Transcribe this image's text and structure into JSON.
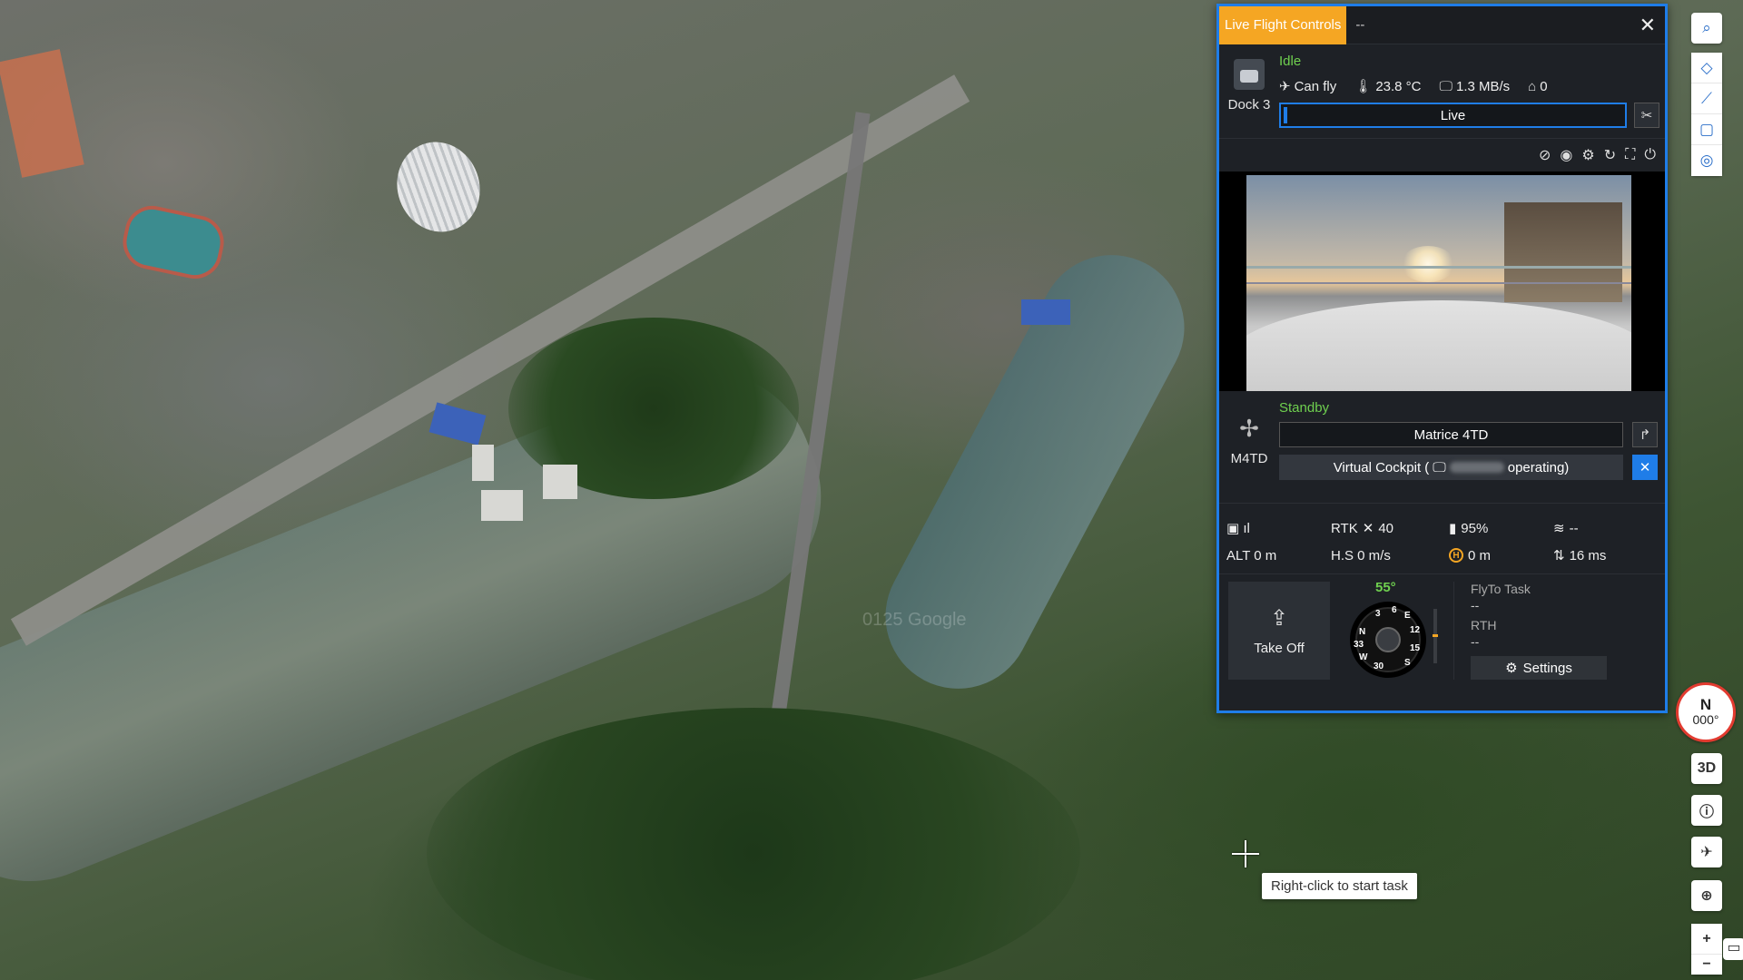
{
  "map": {
    "watermark": "0125 Google",
    "tooltip": "Right-click to start task"
  },
  "panel": {
    "tab_title": "Live Flight Controls",
    "tab_placeholder": "--",
    "dock": {
      "name": "Dock 3",
      "status": "Idle",
      "fly_status": "Can fly",
      "temperature": "23.8 °C",
      "network": "1.3 MB/s",
      "storage": "0",
      "live_label": "Live"
    },
    "drone": {
      "name": "M4TD",
      "status": "Standby",
      "model": "Matrice 4TD",
      "cockpit_prefix": "Virtual Cockpit (",
      "cockpit_suffix": "operating)"
    },
    "telemetry": {
      "signal": "",
      "rtk": "RTK",
      "rtk_count": "40",
      "battery": "95%",
      "wind": "--",
      "alt": "ALT 0 m",
      "hs": "H.S 0 m/s",
      "home_dist": "0 m",
      "latency": "16 ms"
    },
    "controls": {
      "takeoff_label": "Take Off",
      "heading": "55°",
      "flyto_title": "FlyTo Task",
      "flyto_value": "--",
      "rth_title": "RTH",
      "rth_value": "--",
      "settings_label": "Settings"
    },
    "compass_labels": [
      "N",
      "3",
      "6",
      "E",
      "12",
      "15",
      "S",
      "W",
      "30",
      "33"
    ]
  },
  "toolbar": {
    "mode_3d": "3D",
    "north_label": "N",
    "north_heading": "000°"
  },
  "icons": {
    "accent": "#1f7de8",
    "orange": "#f5a623",
    "status_green": "#6fd04f"
  }
}
